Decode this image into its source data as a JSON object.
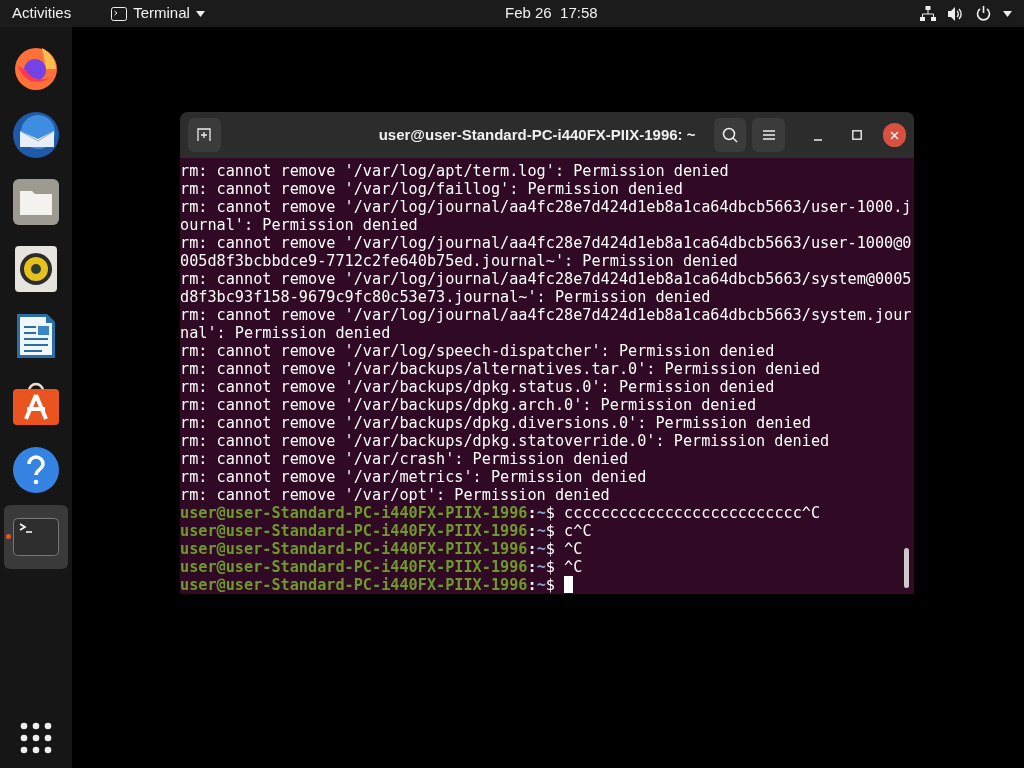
{
  "top_bar": {
    "activities": "Activities",
    "app_menu": "Terminal",
    "clock": "Feb 26  17:58"
  },
  "dock": {
    "items": [
      {
        "kind": "browser",
        "running": false
      },
      {
        "kind": "mail",
        "running": false
      },
      {
        "kind": "files",
        "running": false
      },
      {
        "kind": "music",
        "running": false
      },
      {
        "kind": "writer",
        "running": false
      },
      {
        "kind": "store",
        "running": false
      },
      {
        "kind": "help",
        "running": false
      },
      {
        "kind": "terminal",
        "running": true
      }
    ]
  },
  "terminal": {
    "title": "user@user-Standard-PC-i440FX-PIIX-1996: ~",
    "rows": [
      {
        "kind": "output",
        "text": "rm: cannot remove '/var/log/apt/term.log': Permission denied"
      },
      {
        "kind": "output",
        "text": "rm: cannot remove '/var/log/faillog': Permission denied"
      },
      {
        "kind": "output",
        "text": "rm: cannot remove '/var/log/journal/aa4fc28e7d424d1eb8a1ca64dbcb5663/user-1000.j"
      },
      {
        "kind": "output",
        "text": "ournal': Permission denied"
      },
      {
        "kind": "output",
        "text": "rm: cannot remove '/var/log/journal/aa4fc28e7d424d1eb8a1ca64dbcb5663/user-1000@0"
      },
      {
        "kind": "output",
        "text": "005d8f3bcbbdce9-7712c2fe640b75ed.journal~': Permission denied"
      },
      {
        "kind": "output",
        "text": "rm: cannot remove '/var/log/journal/aa4fc28e7d424d1eb8a1ca64dbcb5663/system@0005"
      },
      {
        "kind": "output",
        "text": "d8f3bc93f158-9679c9fc80c53e73.journal~': Permission denied"
      },
      {
        "kind": "output",
        "text": "rm: cannot remove '/var/log/journal/aa4fc28e7d424d1eb8a1ca64dbcb5663/system.jour"
      },
      {
        "kind": "output",
        "text": "nal': Permission denied"
      },
      {
        "kind": "output",
        "text": "rm: cannot remove '/var/log/speech-dispatcher': Permission denied"
      },
      {
        "kind": "output",
        "text": "rm: cannot remove '/var/backups/alternatives.tar.0': Permission denied"
      },
      {
        "kind": "output",
        "text": "rm: cannot remove '/var/backups/dpkg.status.0': Permission denied"
      },
      {
        "kind": "output",
        "text": "rm: cannot remove '/var/backups/dpkg.arch.0': Permission denied"
      },
      {
        "kind": "output",
        "text": "rm: cannot remove '/var/backups/dpkg.diversions.0': Permission denied"
      },
      {
        "kind": "output",
        "text": "rm: cannot remove '/var/backups/dpkg.statoverride.0': Permission denied"
      },
      {
        "kind": "output",
        "text": "rm: cannot remove '/var/crash': Permission denied"
      },
      {
        "kind": "output",
        "text": "rm: cannot remove '/var/metrics': Permission denied"
      },
      {
        "kind": "output",
        "text": "rm: cannot remove '/var/opt': Permission denied"
      },
      {
        "kind": "prompt",
        "user": "user@user-Standard-PC-i440FX-PIIX-1996",
        "separator": ":",
        "path": "~",
        "sign": "$",
        "command": "cccccccccccccccccccccccccc^C"
      },
      {
        "kind": "prompt",
        "user": "user@user-Standard-PC-i440FX-PIIX-1996",
        "separator": ":",
        "path": "~",
        "sign": "$",
        "command": "c^C"
      },
      {
        "kind": "prompt",
        "user": "user@user-Standard-PC-i440FX-PIIX-1996",
        "separator": ":",
        "path": "~",
        "sign": "$",
        "command": "^C"
      },
      {
        "kind": "prompt",
        "user": "user@user-Standard-PC-i440FX-PIIX-1996",
        "separator": ":",
        "path": "~",
        "sign": "$",
        "command": "^C"
      },
      {
        "kind": "prompt",
        "user": "user@user-Standard-PC-i440FX-PIIX-1996",
        "separator": ":",
        "path": "~",
        "sign": "$",
        "cursor": true
      }
    ]
  }
}
